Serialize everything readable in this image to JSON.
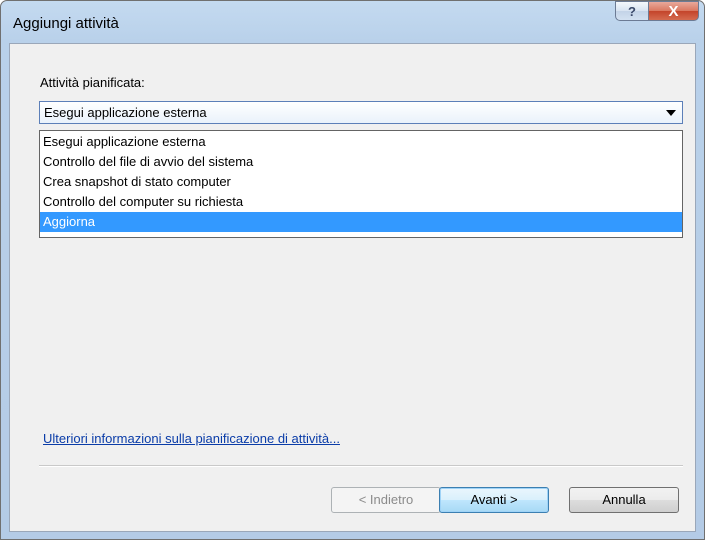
{
  "window": {
    "title": "Aggiungi attività",
    "help_glyph": "?",
    "close_glyph": "X"
  },
  "form": {
    "task_label": "Attività pianificata:",
    "selected_value": "Esegui applicazione esterna",
    "options": [
      "Esegui applicazione esterna",
      "Controllo del file di avvio del sistema",
      "Crea snapshot di stato computer",
      "Controllo del computer su richiesta",
      "Aggiorna"
    ],
    "highlighted_option": "Aggiorna",
    "info_link": "Ulteriori informazioni sulla pianificazione di attività..."
  },
  "buttons": {
    "back": "< Indietro",
    "next": "Avanti >",
    "cancel": "Annulla"
  },
  "colors": {
    "highlight": "#3399ff",
    "link": "#0a3ca8",
    "frame": "#b9d1ea"
  }
}
